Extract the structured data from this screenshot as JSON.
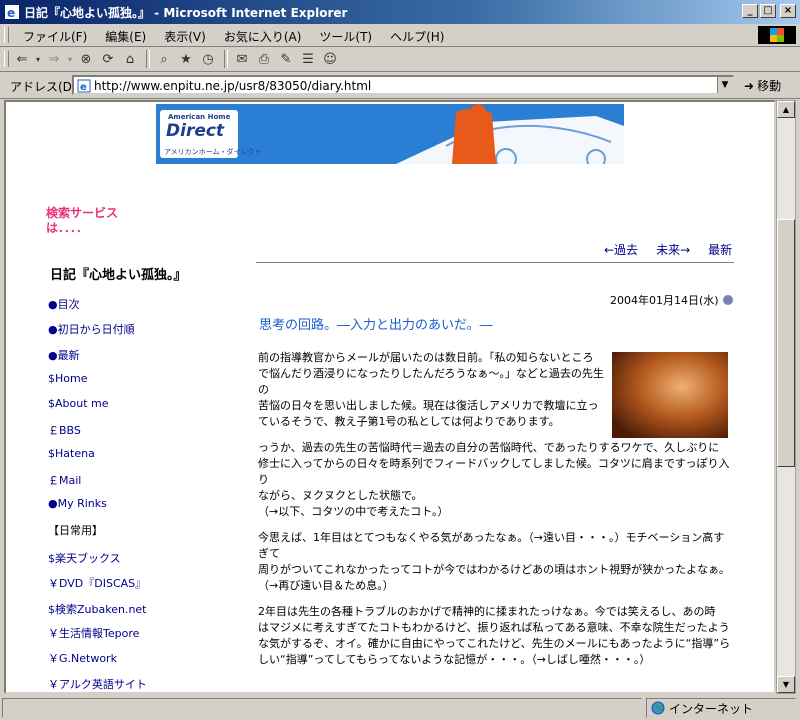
{
  "window": {
    "title": "日記『心地よい孤独。』 - Microsoft Internet Explorer",
    "buttons": {
      "minimize": "_",
      "maximize": "□",
      "close": "×"
    }
  },
  "menu": [
    "ファイル(F)",
    "編集(E)",
    "表示(V)",
    "お気に入り(A)",
    "ツール(T)",
    "ヘルプ(H)"
  ],
  "toolbar": {
    "icons": [
      "back-icon",
      "forward-icon",
      "stop-icon",
      "refresh-icon",
      "home-icon",
      "search-icon",
      "favorites-icon",
      "history-icon",
      "mail-icon",
      "print-icon",
      "edit-icon",
      "discuss-icon",
      "messenger-icon"
    ]
  },
  "address": {
    "label": "アドレス(D)",
    "url": "http://www.enpitu.ne.jp/usr8/83050/diary.html",
    "go": "移動"
  },
  "banner": {
    "small": "American Home",
    "big": "Direct",
    "jp": "アメリカンホーム・ダイレクト"
  },
  "site": {
    "search_line1": "検索サービス",
    "search_line2": "は．．．．"
  },
  "sidebar": {
    "title": "日記『心地よい孤独。』",
    "links": [
      "●目次",
      "●初日から日付順",
      "●最新",
      "$Home",
      "$About me",
      "￡BBS",
      "$Hatena",
      "￡Mail",
      "●My Rinks",
      "【日常用】",
      "$楽天ブックス",
      "￥DVD『DISCAS』",
      "$検索Zubaken.net",
      "￥生活情報Tepore",
      "￥G.Network",
      "￥アルク英語サイト"
    ]
  },
  "nav": {
    "prev": "←過去",
    "next": "未来→",
    "latest": "最新"
  },
  "entry": {
    "date": "2004年01月14日(水)",
    "title": "思考の回路。―入力と出力のあいだ。―",
    "paragraphs": [
      [
        "前の指導教官からメールが届いたのは数日前。「私の知らないところ",
        "で悩んだり酒浸りになったりしたんだろうなぁ〜。」などと過去の先生の",
        "苦悩の日々を思い出しました候。現在は復活しアメリカで教壇に立っ",
        "ているそうで、教え子第1号の私としては何よりであります。"
      ],
      [
        "っうか、過去の先生の苦悩時代＝過去の自分の苦悩時代、であったりするワケで、久しぶりに",
        "修士に入ってからの日々を時系列でフィードバックしてしました候。コタツに肩まですっぽり入り",
        "ながら、ヌクヌクとした状態で。",
        "（→以下、コタツの中で考えたコト。）"
      ],
      [
        "今思えば、1年目はとてつもなくやる気があったなぁ。（→遠い目・・・。）モチベーション高すぎて",
        "周りがついてこれなかったってコトが今ではわかるけどあの頃はホント視野が狭かったよなぁ。",
        "（→再び遠い目＆ため息。）"
      ],
      [
        "2年目は先生の各種トラブルのおかげで精神的に揉まれたっけなぁ。今では笑えるし、あの時",
        "はマジメに考えすぎてたコトもわかるけど、振り返れば私ってある意味、不幸な院生だったよう",
        "な気がするぞ、オイ。確かに自由にやってこれたけど、先生のメールにもあったように“指導”ら",
        "しい“指導”ってしてもらってないような記憶が・・・。（→しばし唖然・・・。）"
      ]
    ]
  },
  "status": {
    "zone": "インターネット"
  }
}
